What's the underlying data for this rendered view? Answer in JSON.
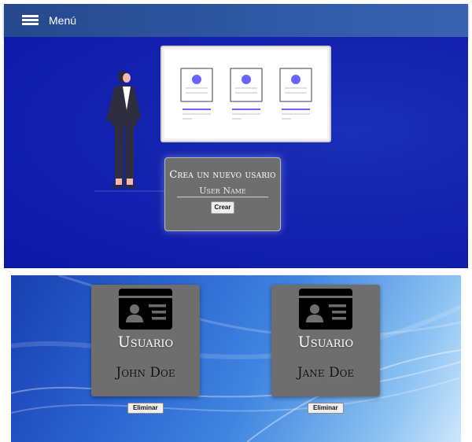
{
  "nav": {
    "menu_icon": "hamburger-list-icon",
    "menu_label": "Menú",
    "color": "#2f5aa6"
  },
  "hero": {
    "background": "#1525b0",
    "illustration": "person-presenting-board-illustration",
    "accent": "#6c63ff",
    "form": {
      "title": "Crea un nuevo usario",
      "input_placeholder": "User Name",
      "input_value": "",
      "submit_label": "Crear"
    }
  },
  "users": {
    "card_icon": "id-card-icon",
    "cards": [
      {
        "role": "Usuario",
        "name": "John Doe",
        "delete_label": "Eliminar"
      },
      {
        "role": "Usuario",
        "name": "Jane Doe",
        "delete_label": "Eliminar"
      }
    ]
  }
}
